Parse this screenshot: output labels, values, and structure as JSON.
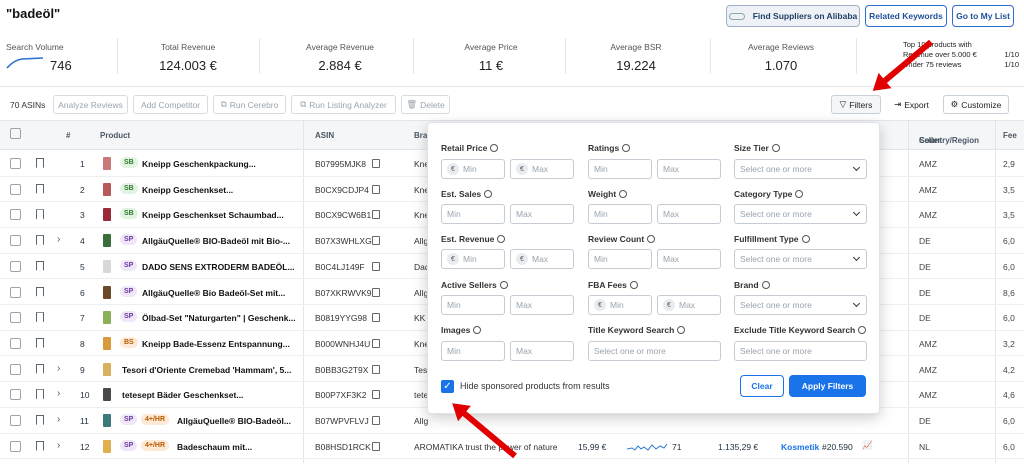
{
  "header": {
    "title": "\"badeöl\"",
    "find_suppliers": "Find Suppliers on Alibaba",
    "related_keywords": "Related Keywords",
    "go_to_list": "Go to My List"
  },
  "stats": [
    {
      "label": "Search Volume",
      "value": "746"
    },
    {
      "label": "Total Revenue",
      "value": "124.003 €"
    },
    {
      "label": "Average Revenue",
      "value": "2.884 €"
    },
    {
      "label": "Average Price",
      "value": "11 €"
    },
    {
      "label": "Average BSR",
      "value": "19.224"
    },
    {
      "label": "Average Reviews",
      "value": "1.070"
    }
  ],
  "top_products": {
    "title": "Top 10 products with",
    "line1": "Revenue over 5.000 €",
    "line1_val": "1/10",
    "line2": "Under 75 reviews",
    "line2_val": "1/10"
  },
  "toolbar": {
    "count": "70 ASINs",
    "analyze_reviews": "Analyze Reviews",
    "add_competitor": "Add Competitor",
    "run_cerebro": "Run Cerebro",
    "run_listing": "Run Listing Analyzer",
    "delete": "Delete",
    "filters": "Filters",
    "export": "Export",
    "customize": "Customize"
  },
  "columns": {
    "num": "#",
    "product": "Product",
    "asin": "ASIN",
    "brand": "Bra",
    "seller": "Seller",
    "seller2": "Country/Region",
    "fee": "Fee"
  },
  "rows": [
    {
      "n": "1",
      "tag": "SB",
      "name": "Kneipp Geschenkpackung...",
      "asin": "B07995MJK8",
      "brand": "Kne",
      "country": "AMZ",
      "fee": "2,9"
    },
    {
      "n": "2",
      "tag": "SB",
      "name": "Kneipp Geschenkset...",
      "asin": "B0CX9CDJP4",
      "brand": "Kne",
      "country": "AMZ",
      "fee": "3,5"
    },
    {
      "n": "3",
      "tag": "SB",
      "name": "Kneipp Geschenkset Schaumbad...",
      "asin": "B0CX9CW6B1",
      "brand": "Kne",
      "country": "AMZ",
      "fee": "3,5"
    },
    {
      "n": "4",
      "tag": "SP",
      "name": "AllgäuQuelle® BIO-Badeöl mit Bio-...",
      "asin": "B07X3WHLXG",
      "brand": "Allg",
      "country": "DE",
      "fee": "6,0"
    },
    {
      "n": "5",
      "tag": "SP",
      "name": "DADO SENS EXTRODERM BADEÖL...",
      "asin": "B0C4LJ149F",
      "brand": "Dad",
      "country": "DE",
      "fee": "6,0"
    },
    {
      "n": "6",
      "tag": "SP",
      "name": "AllgäuQuelle® Bio Badeöl-Set mit...",
      "asin": "B07XKRWVK9",
      "brand": "Allg",
      "country": "DE",
      "fee": "8,6"
    },
    {
      "n": "7",
      "tag": "SP",
      "name": "Ölbad-Set \"Naturgarten\" | Geschenk...",
      "asin": "B0819YYG98",
      "brand": "KK",
      "country": "DE",
      "fee": "6,0"
    },
    {
      "n": "8",
      "tag": "BS",
      "name": "Kneipp Bade-Essenz Entspannung...",
      "asin": "B000WNHJ4U",
      "brand": "Kne",
      "country": "AMZ",
      "fee": "3,2"
    },
    {
      "n": "9",
      "tag": "",
      "name": "Tesori d'Oriente Cremebad 'Hammam', 5...",
      "asin": "B0BB3G2T9X",
      "brand": "Tes",
      "country": "AMZ",
      "fee": "4,2"
    },
    {
      "n": "10",
      "tag": "",
      "name": "tetesept Bäder Geschenkset...",
      "asin": "B00P7XF3K2",
      "brand": "tete",
      "country": "AMZ",
      "fee": "4,6"
    },
    {
      "n": "11",
      "tag": "4+/HR",
      "tag2": "SP",
      "name": "AllgäuQuelle® BIO-Badeöl...",
      "asin": "B07WPVFLVJ",
      "brand": "Allg",
      "country": "DE",
      "fee": "6,0"
    },
    {
      "n": "12",
      "tag": "4+/HR",
      "tag2": "SP",
      "name": "Badeschaum mit...",
      "asin": "B08HSD1RCK",
      "brand": "AROMATIKA trust the power of nature",
      "price": "15,99 €",
      "reviews": "71",
      "revenue": "1.135,29 €",
      "category": "Kosmetik",
      "rank": "#20.590",
      "country": "NL",
      "fee": "6,0"
    }
  ],
  "filters": {
    "retail_price": "Retail Price",
    "ratings": "Ratings",
    "size_tier": "Size Tier",
    "est_sales": "Est. Sales",
    "weight": "Weight",
    "category_type": "Category Type",
    "est_revenue": "Est. Revenue",
    "review_count": "Review Count",
    "fulfillment_type": "Fulfillment Type",
    "active_sellers": "Active Sellers",
    "fba_fees": "FBA Fees",
    "brand": "Brand",
    "images": "Images",
    "title_kw": "Title Keyword Search",
    "excl_title_kw": "Exclude Title Keyword Search",
    "min": "Min",
    "max": "Max",
    "select": "Select one or more",
    "euro": "€",
    "hide_sponsored": "Hide sponsored products from results",
    "clear": "Clear",
    "apply": "Apply Filters"
  },
  "colors": {
    "accent": "#1a73e8",
    "arrow": "#e00000"
  }
}
